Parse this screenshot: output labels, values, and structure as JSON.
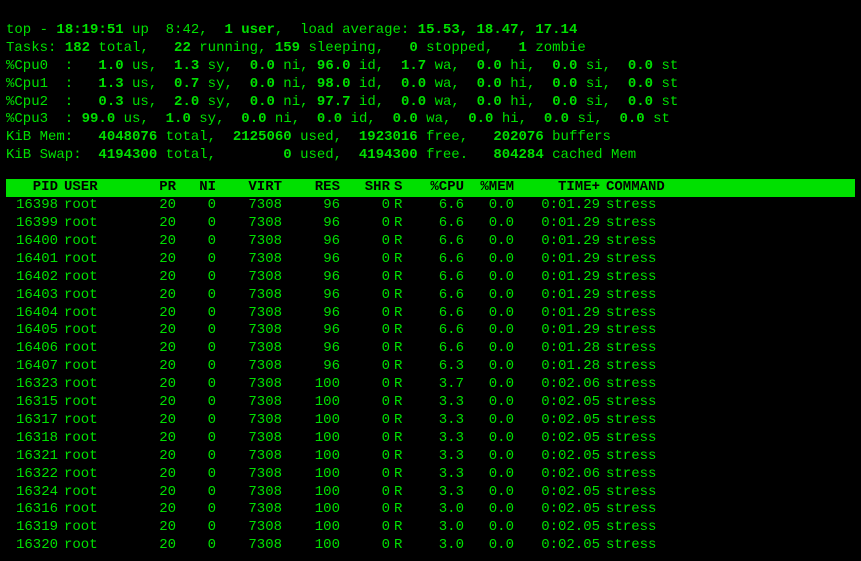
{
  "summary": {
    "line1_a": "top - ",
    "line1_time": "18:19:51",
    "line1_b": " up  8:42,  ",
    "line1_users": "1 user",
    "line1_c": ",  load average: ",
    "line1_load": "15.53, 18.47, 17.14",
    "tasks_label": "Tasks: ",
    "tasks_total": "182",
    "tasks_total_l": " total,   ",
    "tasks_running": "22",
    "tasks_running_l": " running, ",
    "tasks_sleeping": "159",
    "tasks_sleeping_l": " sleeping,   ",
    "tasks_stopped": "0",
    "tasks_stopped_l": " stopped,   ",
    "tasks_zombie": "1",
    "tasks_zombie_l": " zombie",
    "cpu_lines": [
      {
        "label": "%Cpu0  :  ",
        "us": "1.0",
        "sy": "1.3",
        "ni": "0.0",
        "id": "96.0",
        "wa": "1.7",
        "hi": "0.0",
        "si": "0.0",
        "st": "0.0"
      },
      {
        "label": "%Cpu1  :  ",
        "us": "1.3",
        "sy": "0.7",
        "ni": "0.0",
        "id": "98.0",
        "wa": "0.0",
        "hi": "0.0",
        "si": "0.0",
        "st": "0.0"
      },
      {
        "label": "%Cpu2  :  ",
        "us": "0.3",
        "sy": "2.0",
        "ni": "0.0",
        "id": "97.7",
        "wa": "0.0",
        "hi": "0.0",
        "si": "0.0",
        "st": "0.0"
      },
      {
        "label": "%Cpu3  : ",
        "us": "99.0",
        "sy": "1.0",
        "ni": "0.0",
        "id": "0.0",
        "wa": "0.0",
        "hi": "0.0",
        "si": "0.0",
        "st": "0.0"
      }
    ],
    "mem_label": "KiB Mem:   ",
    "mem_total": "4048076",
    "mem_total_l": " total,  ",
    "mem_used": "2125060",
    "mem_used_l": " used,  ",
    "mem_free": "1923016",
    "mem_free_l": " free,   ",
    "mem_buf": "202076",
    "mem_buf_l": " buffers",
    "swap_label": "KiB Swap:  ",
    "swap_total": "4194300",
    "swap_total_l": " total,        ",
    "swap_used": "0",
    "swap_used_l": " used,  ",
    "swap_free": "4194300",
    "swap_free_l": " free.   ",
    "swap_cache": "804284",
    "swap_cache_l": " cached Mem"
  },
  "headers": {
    "pid": "PID",
    "user": "USER",
    "pr": "PR",
    "ni": "NI",
    "virt": "VIRT",
    "res": "RES",
    "shr": "SHR",
    "s": "S",
    "cpu": "%CPU",
    "mem": "%MEM",
    "time": "TIME+",
    "cmd": "COMMAND"
  },
  "rows": [
    {
      "pid": "16398",
      "user": "root",
      "pr": "20",
      "ni": "0",
      "virt": "7308",
      "res": "96",
      "shr": "0",
      "s": "R",
      "cpu": "6.6",
      "mem": "0.0",
      "time": "0:01.29",
      "cmd": "stress"
    },
    {
      "pid": "16399",
      "user": "root",
      "pr": "20",
      "ni": "0",
      "virt": "7308",
      "res": "96",
      "shr": "0",
      "s": "R",
      "cpu": "6.6",
      "mem": "0.0",
      "time": "0:01.29",
      "cmd": "stress"
    },
    {
      "pid": "16400",
      "user": "root",
      "pr": "20",
      "ni": "0",
      "virt": "7308",
      "res": "96",
      "shr": "0",
      "s": "R",
      "cpu": "6.6",
      "mem": "0.0",
      "time": "0:01.29",
      "cmd": "stress"
    },
    {
      "pid": "16401",
      "user": "root",
      "pr": "20",
      "ni": "0",
      "virt": "7308",
      "res": "96",
      "shr": "0",
      "s": "R",
      "cpu": "6.6",
      "mem": "0.0",
      "time": "0:01.29",
      "cmd": "stress"
    },
    {
      "pid": "16402",
      "user": "root",
      "pr": "20",
      "ni": "0",
      "virt": "7308",
      "res": "96",
      "shr": "0",
      "s": "R",
      "cpu": "6.6",
      "mem": "0.0",
      "time": "0:01.29",
      "cmd": "stress"
    },
    {
      "pid": "16403",
      "user": "root",
      "pr": "20",
      "ni": "0",
      "virt": "7308",
      "res": "96",
      "shr": "0",
      "s": "R",
      "cpu": "6.6",
      "mem": "0.0",
      "time": "0:01.29",
      "cmd": "stress"
    },
    {
      "pid": "16404",
      "user": "root",
      "pr": "20",
      "ni": "0",
      "virt": "7308",
      "res": "96",
      "shr": "0",
      "s": "R",
      "cpu": "6.6",
      "mem": "0.0",
      "time": "0:01.29",
      "cmd": "stress"
    },
    {
      "pid": "16405",
      "user": "root",
      "pr": "20",
      "ni": "0",
      "virt": "7308",
      "res": "96",
      "shr": "0",
      "s": "R",
      "cpu": "6.6",
      "mem": "0.0",
      "time": "0:01.29",
      "cmd": "stress"
    },
    {
      "pid": "16406",
      "user": "root",
      "pr": "20",
      "ni": "0",
      "virt": "7308",
      "res": "96",
      "shr": "0",
      "s": "R",
      "cpu": "6.6",
      "mem": "0.0",
      "time": "0:01.28",
      "cmd": "stress"
    },
    {
      "pid": "16407",
      "user": "root",
      "pr": "20",
      "ni": "0",
      "virt": "7308",
      "res": "96",
      "shr": "0",
      "s": "R",
      "cpu": "6.3",
      "mem": "0.0",
      "time": "0:01.28",
      "cmd": "stress"
    },
    {
      "pid": "16323",
      "user": "root",
      "pr": "20",
      "ni": "0",
      "virt": "7308",
      "res": "100",
      "shr": "0",
      "s": "R",
      "cpu": "3.7",
      "mem": "0.0",
      "time": "0:02.06",
      "cmd": "stress"
    },
    {
      "pid": "16315",
      "user": "root",
      "pr": "20",
      "ni": "0",
      "virt": "7308",
      "res": "100",
      "shr": "0",
      "s": "R",
      "cpu": "3.3",
      "mem": "0.0",
      "time": "0:02.05",
      "cmd": "stress"
    },
    {
      "pid": "16317",
      "user": "root",
      "pr": "20",
      "ni": "0",
      "virt": "7308",
      "res": "100",
      "shr": "0",
      "s": "R",
      "cpu": "3.3",
      "mem": "0.0",
      "time": "0:02.05",
      "cmd": "stress"
    },
    {
      "pid": "16318",
      "user": "root",
      "pr": "20",
      "ni": "0",
      "virt": "7308",
      "res": "100",
      "shr": "0",
      "s": "R",
      "cpu": "3.3",
      "mem": "0.0",
      "time": "0:02.05",
      "cmd": "stress"
    },
    {
      "pid": "16321",
      "user": "root",
      "pr": "20",
      "ni": "0",
      "virt": "7308",
      "res": "100",
      "shr": "0",
      "s": "R",
      "cpu": "3.3",
      "mem": "0.0",
      "time": "0:02.05",
      "cmd": "stress"
    },
    {
      "pid": "16322",
      "user": "root",
      "pr": "20",
      "ni": "0",
      "virt": "7308",
      "res": "100",
      "shr": "0",
      "s": "R",
      "cpu": "3.3",
      "mem": "0.0",
      "time": "0:02.06",
      "cmd": "stress"
    },
    {
      "pid": "16324",
      "user": "root",
      "pr": "20",
      "ni": "0",
      "virt": "7308",
      "res": "100",
      "shr": "0",
      "s": "R",
      "cpu": "3.3",
      "mem": "0.0",
      "time": "0:02.05",
      "cmd": "stress"
    },
    {
      "pid": "16316",
      "user": "root",
      "pr": "20",
      "ni": "0",
      "virt": "7308",
      "res": "100",
      "shr": "0",
      "s": "R",
      "cpu": "3.0",
      "mem": "0.0",
      "time": "0:02.05",
      "cmd": "stress"
    },
    {
      "pid": "16319",
      "user": "root",
      "pr": "20",
      "ni": "0",
      "virt": "7308",
      "res": "100",
      "shr": "0",
      "s": "R",
      "cpu": "3.0",
      "mem": "0.0",
      "time": "0:02.05",
      "cmd": "stress"
    },
    {
      "pid": "16320",
      "user": "root",
      "pr": "20",
      "ni": "0",
      "virt": "7308",
      "res": "100",
      "shr": "0",
      "s": "R",
      "cpu": "3.0",
      "mem": "0.0",
      "time": "0:02.05",
      "cmd": "stress"
    }
  ]
}
